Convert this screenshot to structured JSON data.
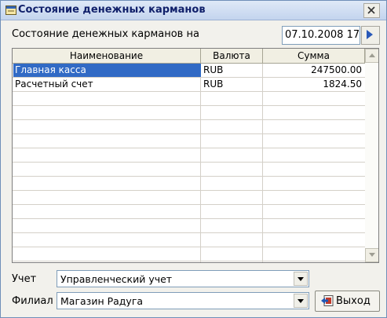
{
  "window": {
    "title": "Состояние денежных карманов"
  },
  "header": {
    "date_label": "Состояние денежных карманов на",
    "date_value": "07.10.2008 17"
  },
  "table": {
    "columns": [
      "Наименование",
      "Валюта",
      "Сумма"
    ],
    "rows": [
      [
        "Главная касса",
        "RUB",
        "247500.00"
      ],
      [
        "Расчетный счет",
        "RUB",
        "1824.50"
      ]
    ],
    "selected_row": 0
  },
  "filters": {
    "account_label": "Учет",
    "account_value": "Управленческий учет",
    "branch_label": "Филиал",
    "branch_value": "Магазин Радуга"
  },
  "buttons": {
    "exit_label": "Выход"
  },
  "colors": {
    "selection": "#316ac5",
    "title_text": "#10206a"
  },
  "icons": [
    "app-icon",
    "close-icon",
    "arrow-right-icon",
    "chevron-down-icon",
    "exit-icon"
  ]
}
